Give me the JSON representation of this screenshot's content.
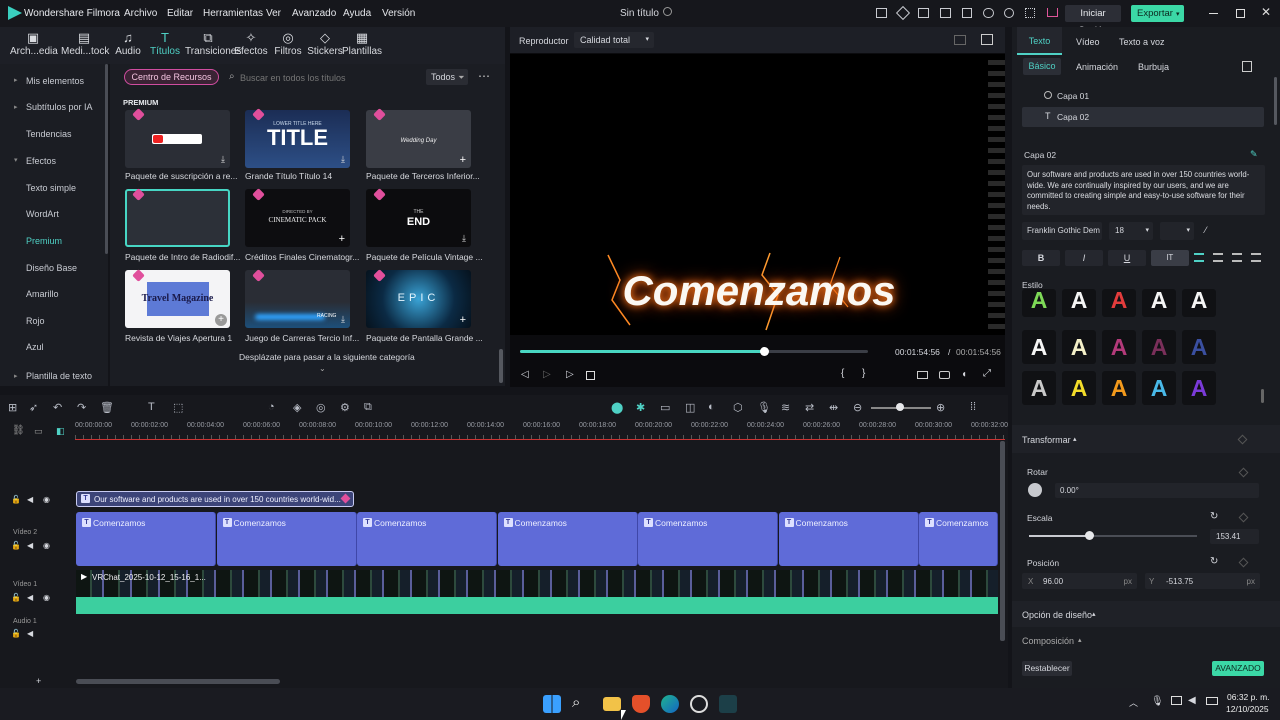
{
  "app": {
    "name": "Wondershare Filmora",
    "project_title": "Sin título",
    "signin": "Iniciar Sesión",
    "export": "Exportar"
  },
  "menu": [
    "Archivo",
    "Editar",
    "Herramientas",
    "Ver",
    "Avanzado",
    "Ayuda",
    "Versión"
  ],
  "toolbar": [
    "Arch...edia",
    "Medi...tock",
    "Audio",
    "Títulos",
    "Transiciones",
    "Efectos",
    "Filtros",
    "Stickers",
    "Plantillas"
  ],
  "leftnav": [
    "Mis elementos",
    "Subtítulos por IA",
    "Tendencias",
    "Efectos",
    "Texto simple",
    "WordArt",
    "Premium",
    "Diseño Base",
    "Amarillo",
    "Rojo",
    "Azul",
    "Plantilla de texto"
  ],
  "library": {
    "resource_center": "Centro de Recursos",
    "search_placeholder": "Buscar en todos los títulos",
    "filter": "Todos",
    "section": "PREMIUM",
    "items": [
      "Paquete de suscripción a re...",
      "Grande Título Título 14",
      "Paquete de Terceros Inferior...",
      "Paquete de Intro de Radiodif...",
      "Créditos Finales Cinematogr...",
      "Paquete de Película Vintage ...",
      "Revista de Viajes Apertura 1",
      "Juego de Carreras Tercio Inf...",
      "Paquete de Pantalla Grande ..."
    ],
    "thumb_texts": [
      "",
      "LOWER TITLE HERE",
      "TITLE",
      "Wedding Day",
      "DIRECTED BY",
      "CINEMATIC PACK",
      "THE",
      "END",
      "Travel Magazine",
      "RACING",
      "EPIC"
    ],
    "scroll_hint": "Desplázate para pasar a la siguiente categoría"
  },
  "preview": {
    "player": "Reproductor",
    "quality": "Calidad total",
    "headline": "Comenzamos",
    "current_time": "00:01:54:56",
    "total_time": "00:01:54:56",
    "progress": 0.7
  },
  "rightpanel": {
    "tabs": [
      "Texto",
      "Vídeo",
      "Texto a voz"
    ],
    "subtabs": [
      "Básico",
      "Animación",
      "Burbuja"
    ],
    "layers": [
      "Capa 01",
      "Capa 02"
    ],
    "layer_label": "Capa 02",
    "text_body": "Our software and products are used in over 150 countries world-wide. We are continually inspired by our users, and we are committed to creating simple and easy-to-use software for their needs.",
    "font": "Franklin Gothic Dem",
    "size": "18",
    "style_label": "Estilo",
    "transform": "Transformar",
    "rotate_label": "Rotar",
    "rotate_value": "0.00°",
    "scale_label": "Escala",
    "scale_value": "153.41",
    "scale_level": 0.36,
    "position_label": "Posición",
    "pos_x_label": "X",
    "pos_x": "96.00",
    "pos_y_label": "Y",
    "pos_y": "-513.75",
    "unit": "px",
    "design_option": "Opción de diseño",
    "composition": "Composición",
    "reset": "Restablecer",
    "advanced": "AVANZADO"
  },
  "timeline": {
    "ruler": [
      "00:00:00:00",
      "00:00:02:00",
      "00:00:04:00",
      "00:00:06:00",
      "00:00:08:00",
      "00:00:10:00",
      "00:00:12:00",
      "00:00:14:00",
      "00:00:16:00",
      "00:00:18:00",
      "00:00:20:00",
      "00:00:22:00",
      "00:00:24:00",
      "00:00:26:00",
      "00:00:28:00",
      "00:00:30:00",
      "00:00:32:00"
    ],
    "subtitle_clip": "Our software and products are used in over 150 countries world-wid...",
    "title_clip": "Comenzamos",
    "video_clip": "VRChat_2025-10-12_15-16_1...",
    "tracks": [
      "Vídeo 2",
      "Vídeo 1",
      "Audio 1"
    ]
  },
  "taskbar": {
    "time": "06:32 p. m.",
    "date": "12/10/2025"
  },
  "colors": {
    "accent": "#4fd1c5",
    "title_clip": "#5f6bd8",
    "audio": "#3ccf9f"
  }
}
